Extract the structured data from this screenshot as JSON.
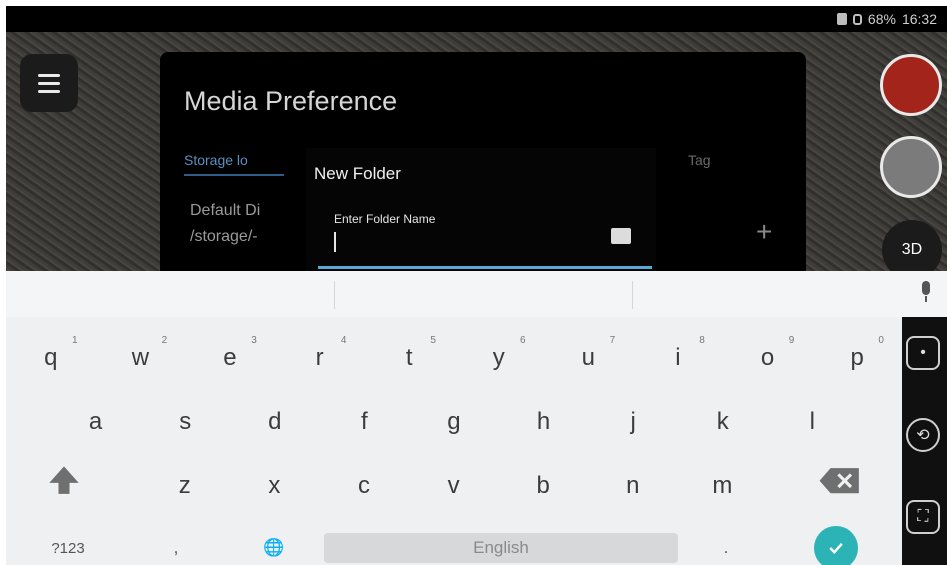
{
  "status_bar": {
    "battery": "68%",
    "time": "16:32"
  },
  "camera_controls": {
    "label_3d": "3D"
  },
  "media_panel": {
    "title": "Media Preference",
    "tab_storage": "Storage lo",
    "tab_tag": "Tag",
    "default_dir_label": "Default Di",
    "path_text": "/storage/-"
  },
  "dialog": {
    "title": "New Folder",
    "field_label": "Enter Folder Name",
    "field_value": ""
  },
  "keyboard": {
    "row1": [
      {
        "key": "q",
        "hint": "1"
      },
      {
        "key": "w",
        "hint": "2"
      },
      {
        "key": "e",
        "hint": "3"
      },
      {
        "key": "r",
        "hint": "4"
      },
      {
        "key": "t",
        "hint": "5"
      },
      {
        "key": "y",
        "hint": "6"
      },
      {
        "key": "u",
        "hint": "7"
      },
      {
        "key": "i",
        "hint": "8"
      },
      {
        "key": "o",
        "hint": "9"
      },
      {
        "key": "p",
        "hint": "0"
      }
    ],
    "row2": [
      "a",
      "s",
      "d",
      "f",
      "g",
      "h",
      "j",
      "k",
      "l"
    ],
    "row3": [
      "z",
      "x",
      "c",
      "v",
      "b",
      "n",
      "m"
    ],
    "symbols_label": "?123",
    "comma_label": ",",
    "space_label": "English",
    "period_label": "."
  }
}
